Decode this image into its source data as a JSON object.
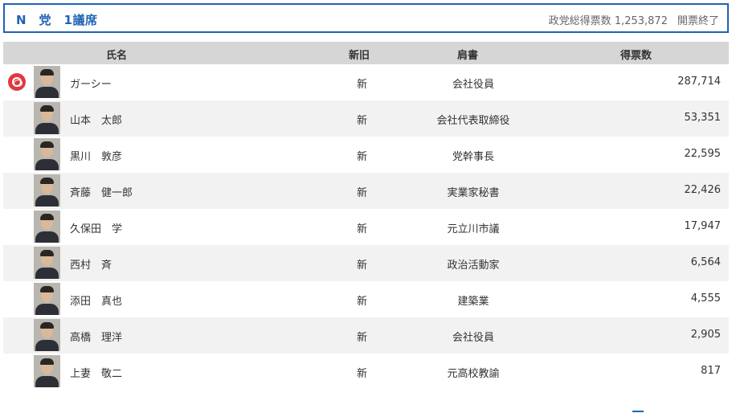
{
  "party": {
    "name": "N　党　1議席",
    "total_label": "政党総得票数",
    "total_votes": "1,253,872",
    "status": "開票終了"
  },
  "table": {
    "headers": {
      "name": "氏名",
      "newold": "新旧",
      "title": "肩書",
      "votes": "得票数"
    },
    "rows": [
      {
        "name": "ガーシー",
        "newold": "新",
        "title": "会社役員",
        "votes": "287,714",
        "elected": true
      },
      {
        "name": "山本　太郎",
        "newold": "新",
        "title": "会社代表取締役",
        "votes": "53,351",
        "elected": false
      },
      {
        "name": "黒川　敦彦",
        "newold": "新",
        "title": "党幹事長",
        "votes": "22,595",
        "elected": false
      },
      {
        "name": "斉藤　健一郎",
        "newold": "新",
        "title": "実業家秘書",
        "votes": "22,426",
        "elected": false
      },
      {
        "name": "久保田　学",
        "newold": "新",
        "title": "元立川市議",
        "votes": "17,947",
        "elected": false
      },
      {
        "name": "西村　斉",
        "newold": "新",
        "title": "政治活動家",
        "votes": "6,564",
        "elected": false
      },
      {
        "name": "添田　真也",
        "newold": "新",
        "title": "建築業",
        "votes": "4,555",
        "elected": false
      },
      {
        "name": "高橋　理洋",
        "newold": "新",
        "title": "会社役員",
        "votes": "2,905",
        "elected": false
      },
      {
        "name": "上妻　敬二",
        "newold": "新",
        "title": "元高校教諭",
        "votes": "817",
        "elected": false
      }
    ]
  }
}
